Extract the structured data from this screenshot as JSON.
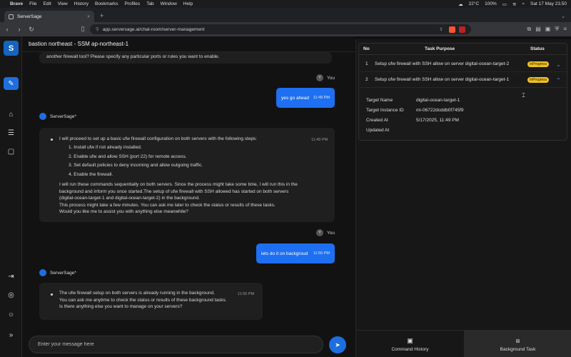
{
  "menubar": {
    "app": "Brave",
    "items": [
      "File",
      "Edit",
      "View",
      "History",
      "Bookmarks",
      "Profiles",
      "Tab",
      "Window",
      "Help"
    ],
    "temperature": "22°C",
    "battery": "100%",
    "datetime": "Sat 17 May 23.50"
  },
  "browser": {
    "tab_title": "ServerSage",
    "url": "app.serversage.ai/chat-room/server-management",
    "shields_count": "3"
  },
  "chat": {
    "header": "bastion northeast - SSM ap-northeast-1",
    "top_fragment": "another firewall tool? Please specify any particular ports or rules you want to enable.",
    "user_name": "You",
    "user_avatar": "Y",
    "bot_name": "ServerSage*",
    "msg1_text": "yes go ahead",
    "msg1_time": "11:49 PM",
    "bot1_intro": "I will proceed to set up a basic ufw firewall configuration on both servers with the following steps:",
    "bot1_time": "11:49 PM",
    "bot1_steps": [
      "1. Install ufw if not already installed.",
      "2. Enable ufw and allow SSH (port 22) for remote access.",
      "3. Set default policies to deny incoming and allow outgoing traffic.",
      "4. Enable the firewall."
    ],
    "bot1_para": [
      "I will run these commands sequentially on both servers. Since the process might take some time, I will run this in the",
      "background and inform you once started.The setup of ufw firewall with SSH allowed has started on both servers",
      "(digital-ocean-target-1 and digital-ocean-target-2) in the background.",
      "This process might take a few minutes. You can ask me later to check the status or results of these tasks.",
      "Would you like me to assist you with anything else meanwhile?"
    ],
    "msg2_text": "lets do it on backgroud",
    "msg2_time": "11:50 PM",
    "bot2_lines": [
      "The ufw firewall setup on both servers is already running in the background.",
      "You can ask me anytime to check the status or results of these background tasks.",
      "Is there anything else you want to manage on your servers?"
    ],
    "bot2_time": "11:50 PM",
    "input_placeholder": "Enter your message here"
  },
  "tasks": {
    "columns": [
      "No",
      "Task Purpose",
      "Status"
    ],
    "rows": [
      {
        "no": "1",
        "purpose": "Setup ufw firewall with SSH allow on server digital-ocean-target-2",
        "status": "InProgress"
      },
      {
        "no": "2",
        "purpose": "Setup ufw firewall with SSH allow on server digital-ocean-target-1",
        "status": "InProgress"
      }
    ],
    "details": [
      {
        "key": "Target Name",
        "value": "digital-ocean-target-1"
      },
      {
        "key": "Target Instance ID",
        "value": "mi-06722dcddb0f745f9"
      },
      {
        "key": "Created At",
        "value": "5/17/2025, 11:49 PM"
      },
      {
        "key": "Updated At",
        "value": ""
      }
    ]
  },
  "bottom_tabs": {
    "command_history": "Command History",
    "background_task": "Background Task"
  },
  "colors": {
    "accent": "#1d6fe0",
    "badge": "#f2c21b",
    "background": "#121212"
  }
}
